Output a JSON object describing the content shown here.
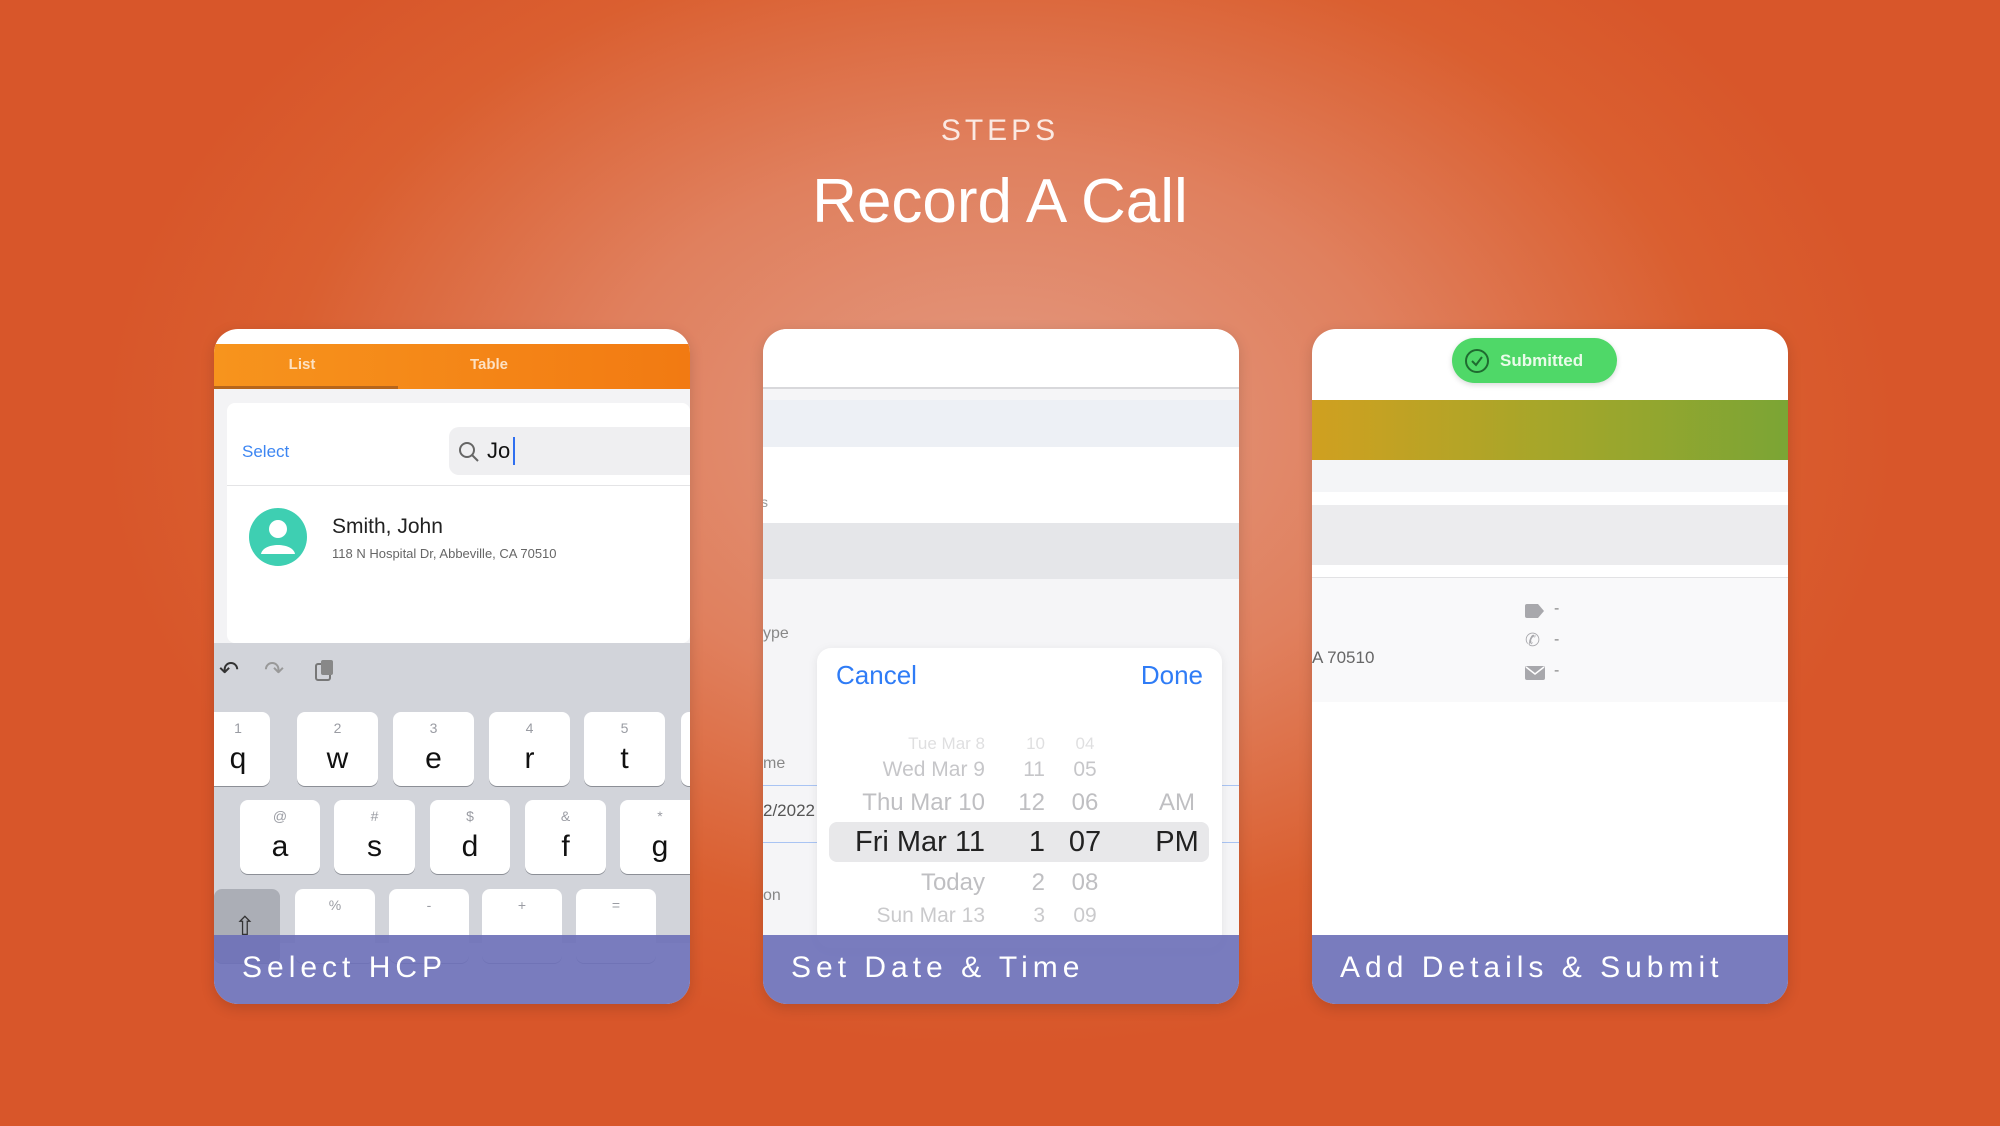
{
  "header": {
    "eyebrow": "STEPS",
    "title": "Record A Call"
  },
  "colors": {
    "accent_orange": "#f7941d",
    "ios_blue": "#2f7cf6",
    "submitted_green": "#4cd964",
    "avatar_teal": "#3ecfb2",
    "caption_band": "#6e71b9"
  },
  "step1": {
    "caption": "Select HCP",
    "tabs": [
      {
        "label": "List",
        "active": true
      },
      {
        "label": "Table",
        "active": false
      }
    ],
    "select_label": "Select",
    "search": {
      "value": "Jo",
      "icon": "search-icon"
    },
    "result": {
      "name": "Smith, John",
      "address": "118 N Hospital Dr, Abbeville, CA 70510",
      "icon": "person-avatar-icon"
    },
    "toolbar_icons": [
      "undo-icon",
      "redo-icon",
      "paste-icon"
    ],
    "keys_row1": [
      {
        "n": "1",
        "l": "q"
      },
      {
        "n": "2",
        "l": "w"
      },
      {
        "n": "3",
        "l": "e"
      },
      {
        "n": "4",
        "l": "r"
      },
      {
        "n": "5",
        "l": "t"
      }
    ],
    "keys_row2": [
      {
        "n": "@",
        "l": "a"
      },
      {
        "n": "#",
        "l": "s"
      },
      {
        "n": "$",
        "l": "d"
      },
      {
        "n": "&",
        "l": "f"
      },
      {
        "n": "*",
        "l": "g"
      }
    ],
    "keys_row3": [
      {
        "n": "%"
      },
      {
        "n": "-"
      },
      {
        "n": "+"
      },
      {
        "n": "="
      }
    ]
  },
  "step2": {
    "caption": "Set Date & Time",
    "cancel": "Cancel",
    "done": "Done",
    "bg_fragments": {
      "a": "s",
      "b": "ype",
      "c": "me",
      "d": "2/2022",
      "e": "on"
    },
    "picker": {
      "dates": [
        "Tue Mar 8",
        "Wed Mar 9",
        "Thu Mar 10",
        "Fri Mar 11",
        "Today",
        "Sun Mar 13"
      ],
      "hours": [
        "10",
        "11",
        "12",
        "1",
        "2",
        "3"
      ],
      "minutes": [
        "04",
        "05",
        "06",
        "07",
        "08",
        "09"
      ],
      "ampm": [
        "",
        "",
        "AM",
        "PM",
        "",
        ""
      ],
      "selected_index": 3
    }
  },
  "step3": {
    "caption": "Add Details & Submit",
    "status": "Submitted",
    "address_fragment": "A 70510",
    "contacts": [
      {
        "icon": "tag-icon",
        "value": "-"
      },
      {
        "icon": "phone-icon",
        "value": "-"
      },
      {
        "icon": "email-icon",
        "value": "-"
      }
    ]
  }
}
